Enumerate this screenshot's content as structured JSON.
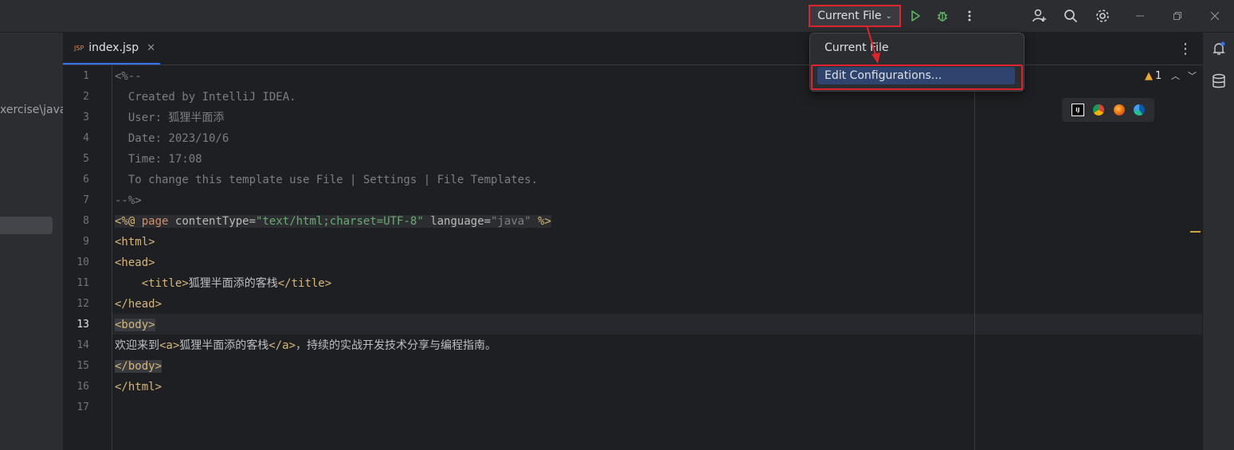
{
  "titlebar": {
    "run_config_label": "Current File",
    "icons": [
      "run-icon",
      "debug-icon",
      "more-icon",
      "add-user-icon",
      "search-icon",
      "settings-icon",
      "minimize-icon",
      "restore-icon",
      "close-icon"
    ]
  },
  "project": {
    "path_fragment": "xercise\\java"
  },
  "tabs": [
    {
      "badge": "JSP",
      "label": "index.jsp"
    }
  ],
  "editor": {
    "current_line": 13,
    "warning_count": "1",
    "lines": [
      {
        "num": "1",
        "text": "<%--"
      },
      {
        "num": "2",
        "text": "  Created by IntelliJ IDEA."
      },
      {
        "num": "3",
        "text": "  User: 狐狸半面添"
      },
      {
        "num": "4",
        "text": "  Date: 2023/10/6"
      },
      {
        "num": "5",
        "text": "  Time: 17:08"
      },
      {
        "num": "6",
        "text": "  To change this template use File | Settings | File Templates."
      },
      {
        "num": "7",
        "text": "--%>"
      },
      {
        "num": "8",
        "text": "<%@ page contentType=\"text/html;charset=UTF-8\" language=\"java\" %>"
      },
      {
        "num": "9",
        "text": "<html>"
      },
      {
        "num": "10",
        "text": "<head>"
      },
      {
        "num": "11",
        "text": "    <title>狐狸半面添的客栈</title>"
      },
      {
        "num": "12",
        "text": "</head>"
      },
      {
        "num": "13",
        "text": "<body>"
      },
      {
        "num": "14",
        "text": "欢迎来到<a>狐狸半面添的客栈</a>，持续的实战开发技术分享与编程指南。"
      },
      {
        "num": "15",
        "text": "</body>"
      },
      {
        "num": "16",
        "text": "</html>"
      },
      {
        "num": "17",
        "text": ""
      }
    ],
    "browser_icons": [
      "intellij-icon",
      "chrome-icon",
      "firefox-icon",
      "edge-icon"
    ]
  },
  "dropdown": {
    "items": [
      "Current File",
      "Edit Configurations..."
    ],
    "highlighted_index": 1
  },
  "colors": {
    "accent": "#3574f0",
    "annotation_red": "#e0242b",
    "selection": "#2e436e"
  }
}
